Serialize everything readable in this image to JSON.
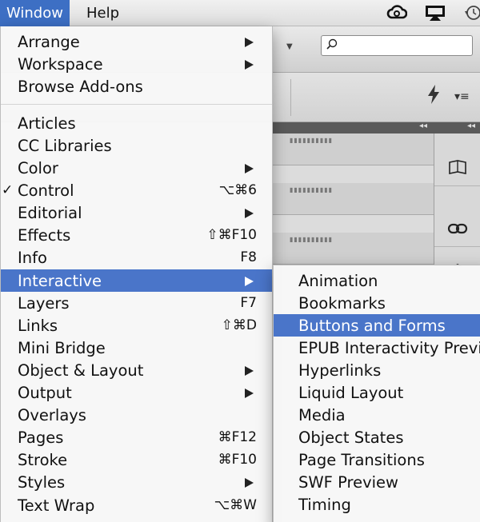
{
  "menubar": {
    "items": [
      {
        "label": "Window",
        "active": true
      },
      {
        "label": "Help",
        "active": false
      }
    ],
    "status_icons": [
      "creative-cloud-icon",
      "airplay-icon",
      "time-machine-icon"
    ]
  },
  "background_app": {
    "search_placeholder": "",
    "panel_collapse_glyph": "◂◂"
  },
  "window_menu": {
    "items": [
      {
        "label": "Arrange",
        "submenu": true,
        "shortcut": "",
        "checked": false
      },
      {
        "label": "Workspace",
        "submenu": true,
        "shortcut": "",
        "checked": false
      },
      {
        "label": "Browse Add-ons",
        "submenu": false,
        "shortcut": "",
        "checked": false
      },
      {
        "label": "Articles",
        "submenu": false,
        "shortcut": "",
        "checked": false
      },
      {
        "label": "CC Libraries",
        "submenu": false,
        "shortcut": "",
        "checked": false
      },
      {
        "label": "Color",
        "submenu": true,
        "shortcut": "",
        "checked": false
      },
      {
        "label": "Control",
        "submenu": false,
        "shortcut": "⌥⌘6",
        "checked": true
      },
      {
        "label": "Editorial",
        "submenu": true,
        "shortcut": "",
        "checked": false
      },
      {
        "label": "Effects",
        "submenu": false,
        "shortcut": "⇧⌘F10",
        "checked": false
      },
      {
        "label": "Info",
        "submenu": false,
        "shortcut": "F8",
        "checked": false
      },
      {
        "label": "Interactive",
        "submenu": true,
        "shortcut": "",
        "checked": false,
        "highlighted": true
      },
      {
        "label": "Layers",
        "submenu": false,
        "shortcut": "F7",
        "checked": false
      },
      {
        "label": "Links",
        "submenu": false,
        "shortcut": "⇧⌘D",
        "checked": false
      },
      {
        "label": "Mini Bridge",
        "submenu": false,
        "shortcut": "",
        "checked": false
      },
      {
        "label": "Object & Layout",
        "submenu": true,
        "shortcut": "",
        "checked": false
      },
      {
        "label": "Output",
        "submenu": true,
        "shortcut": "",
        "checked": false
      },
      {
        "label": "Overlays",
        "submenu": false,
        "shortcut": "",
        "checked": false
      },
      {
        "label": "Pages",
        "submenu": false,
        "shortcut": "⌘F12",
        "checked": false
      },
      {
        "label": "Stroke",
        "submenu": false,
        "shortcut": "⌘F10",
        "checked": false
      },
      {
        "label": "Styles",
        "submenu": true,
        "shortcut": "",
        "checked": false
      },
      {
        "label": "Text Wrap",
        "submenu": false,
        "shortcut": "⌥⌘W",
        "checked": false
      }
    ],
    "check_glyph": "✓"
  },
  "interactive_submenu": {
    "items": [
      {
        "label": "Animation",
        "highlighted": false
      },
      {
        "label": "Bookmarks",
        "highlighted": false
      },
      {
        "label": "Buttons and Forms",
        "highlighted": true
      },
      {
        "label": "EPUB Interactivity Previ",
        "highlighted": false
      },
      {
        "label": "Hyperlinks",
        "highlighted": false
      },
      {
        "label": "Liquid Layout",
        "highlighted": false
      },
      {
        "label": "Media",
        "highlighted": false
      },
      {
        "label": "Object States",
        "highlighted": false
      },
      {
        "label": "Page Transitions",
        "highlighted": false
      },
      {
        "label": "SWF Preview",
        "highlighted": false
      },
      {
        "label": "Timing",
        "highlighted": false
      }
    ]
  },
  "colors": {
    "menu_highlight": "#4a75c9",
    "menubar_active": "#3d6fc4"
  }
}
